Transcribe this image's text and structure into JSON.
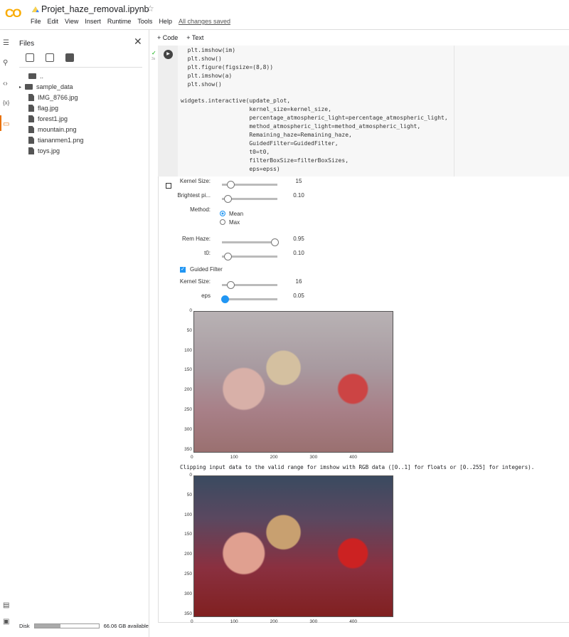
{
  "header": {
    "logo": "CO",
    "title": "Projet_haze_removal.ipynb",
    "menu": [
      "File",
      "Edit",
      "View",
      "Insert",
      "Runtime",
      "Tools",
      "Help"
    ],
    "save_status": "All changes saved"
  },
  "sidebar": {
    "title": "Files",
    "files": [
      {
        "name": "..",
        "type": "parent"
      },
      {
        "name": "sample_data",
        "type": "folder"
      },
      {
        "name": "IMG_8766.jpg",
        "type": "file"
      },
      {
        "name": "flag.jpg",
        "type": "file"
      },
      {
        "name": "forest1.jpg",
        "type": "file"
      },
      {
        "name": "mountain.png",
        "type": "file"
      },
      {
        "name": "tiananmen1.png",
        "type": "file"
      },
      {
        "name": "toys.jpg",
        "type": "file"
      }
    ],
    "disk_label": "Disk",
    "disk_available": "66.06 GB available",
    "disk_used_fraction": 0.4
  },
  "toolbar": {
    "code": "+ Code",
    "text": "+ Text"
  },
  "cell": {
    "exec_time": "3s",
    "code": "  plt.imshow(im)\n  plt.show()\n  plt.figure(figsize=(8,8))\n  plt.imshow(a)\n  plt.show()\n\nwidgets.interactive(update_plot,\n                    kernel_size=kernel_size,\n                    percentage_atmospheric_light=percentage_atmospheric_light,\n                    method_atmospheric_light=method_atmospheric_light,\n                    Remaining_haze=Remaining_haze,\n                    GuidedFilter=GuidedFilter,\n                    t0=t0,\n                    filterBoxSize=filterBoxSizes,\n                    eps=epss)"
  },
  "widgets": {
    "kernel": {
      "label": "Kernel Size:",
      "value": "15",
      "fraction": 0.15
    },
    "bright": {
      "label": "Brightest pi...",
      "value": "0.10",
      "fraction": 0.1
    },
    "method": {
      "label": "Method:",
      "options": [
        "Mean",
        "Max"
      ],
      "selected": "Mean"
    },
    "haze": {
      "label": "Rem Haze:",
      "value": "0.95",
      "fraction": 0.95
    },
    "t0": {
      "label": "t0:",
      "value": "0.10",
      "fraction": 0.1
    },
    "guided": {
      "label": "Guided Filter",
      "checked": true
    },
    "gkernel": {
      "label": "Kernel Size:",
      "value": "16",
      "fraction": 0.16
    },
    "eps": {
      "label": "eps",
      "value": "0.05",
      "fraction": 0.05
    }
  },
  "plot": {
    "yticks": [
      "0",
      "50",
      "100",
      "150",
      "200",
      "250",
      "300",
      "350"
    ],
    "xticks": [
      "0",
      "100",
      "200",
      "300",
      "400"
    ]
  },
  "warning": "Clipping input data to the valid range for imshow with RGB data ([0..1] for floats or [0..255] for integers)."
}
